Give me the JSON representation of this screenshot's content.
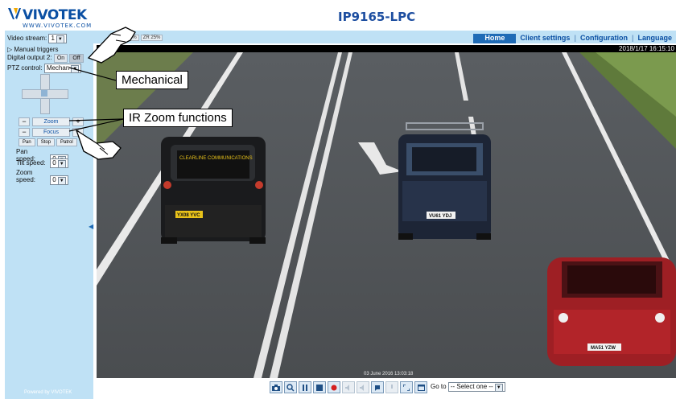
{
  "app": {
    "logo_text": "VIVOTEK",
    "logo_url": "WWW.VIVOTEK.COM",
    "title": "IP9165-LPC",
    "timestamp": "2018/1/17 16:15:10",
    "video_caption": "03 June 2016 13:03:18"
  },
  "nav": {
    "items": [
      "Home",
      "Client settings",
      "Configuration",
      "Language"
    ]
  },
  "zoom_labels": [
    "ZR 50%",
    "ZR 25%"
  ],
  "sidebar": {
    "video_stream_label": "Video stream:",
    "video_stream_value": "1",
    "manual_triggers": "Manual triggers",
    "digital_output_label": "Digital output 2:",
    "digital_output_on": "On",
    "digital_output_off": "Off",
    "ptz_control_label": "PTZ control:",
    "ptz_control_value": "Mechan",
    "zoom_label": "Zoom",
    "focus_label": "Focus",
    "pan_btn": "Pan",
    "stop_btn": "Stop",
    "patrol_btn": "Patrol",
    "pan_speed_label": "Pan speed:",
    "pan_speed_value": "0",
    "tilt_speed_label": "Tilt speed:",
    "tilt_speed_value": "0",
    "zoom_speed_label": "Zoom speed:",
    "zoom_speed_value": "0",
    "powered_by": "Powered by VIVOTEK"
  },
  "callouts": {
    "mechanical": "Mechanical",
    "ir_zoom": "IR Zoom functions"
  },
  "toolbar": {
    "goto_label": "Go to",
    "goto_select": "-- Select one --"
  },
  "plates": {
    "van": "YX08 YVC",
    "suv": "VU61 YDJ",
    "red_car": "MA51 YZW"
  },
  "van_sign": "CLEARLINE COMMUNICATIONS",
  "colors": {
    "accent": "#1f6bb6",
    "panel": "#bfe1f5",
    "title": "#1d4ea0"
  }
}
